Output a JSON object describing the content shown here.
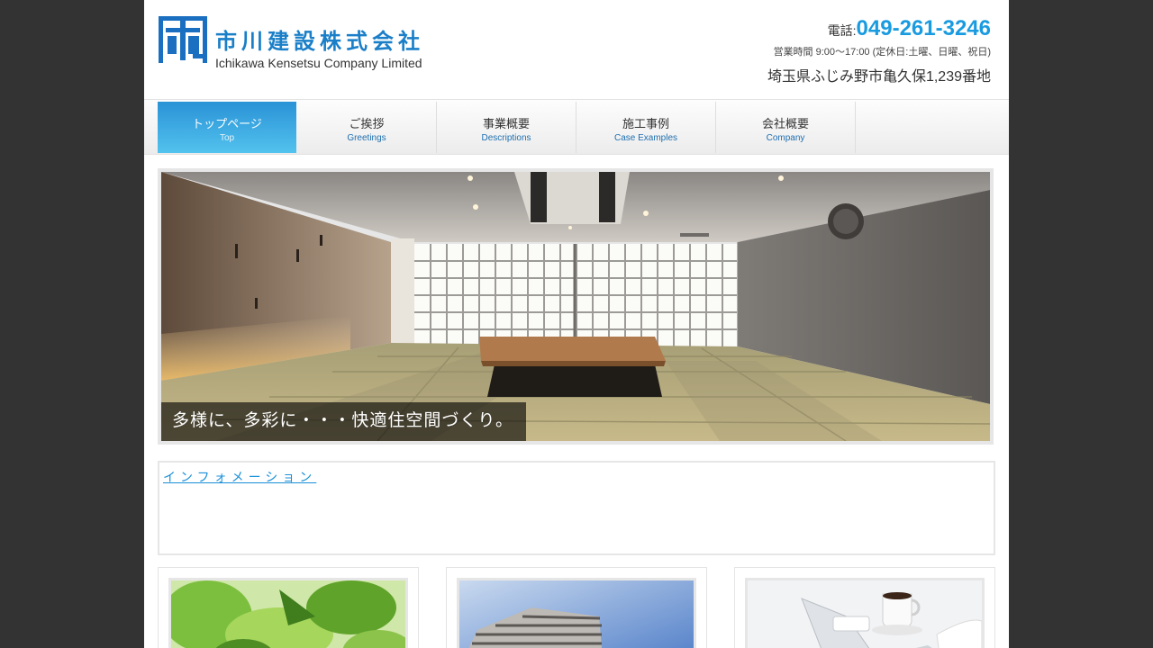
{
  "header": {
    "company_name_jp": "市川建設株式会社",
    "company_name_en": "Ichikawa Kensetsu Company Limited",
    "phone_label": "電話:",
    "phone_number": "049-261-3246",
    "business_hours": "営業時間 9:00～17:00 (定休日:土曜、日曜、祝日)",
    "address": "埼玉県ふじみ野市亀久保1,239番地"
  },
  "nav": {
    "items": [
      {
        "label": "トップページ",
        "sublabel": "Top",
        "active": true
      },
      {
        "label": "ご挨拶",
        "sublabel": "Greetings"
      },
      {
        "label": "事業概要",
        "sublabel": "Descriptions"
      },
      {
        "label": "施工事例",
        "sublabel": "Case Examples"
      },
      {
        "label": "会社概要",
        "sublabel": "Company"
      }
    ]
  },
  "hero": {
    "caption": "多様に、多彩に・・・快適住空間づくり。"
  },
  "info": {
    "heading": "インフォメーション"
  },
  "colors": {
    "brand_blue": "#1a7fc8",
    "phone_blue": "#1a9be0",
    "nav_active": "#2a92d6",
    "page_bg": "#333333"
  }
}
